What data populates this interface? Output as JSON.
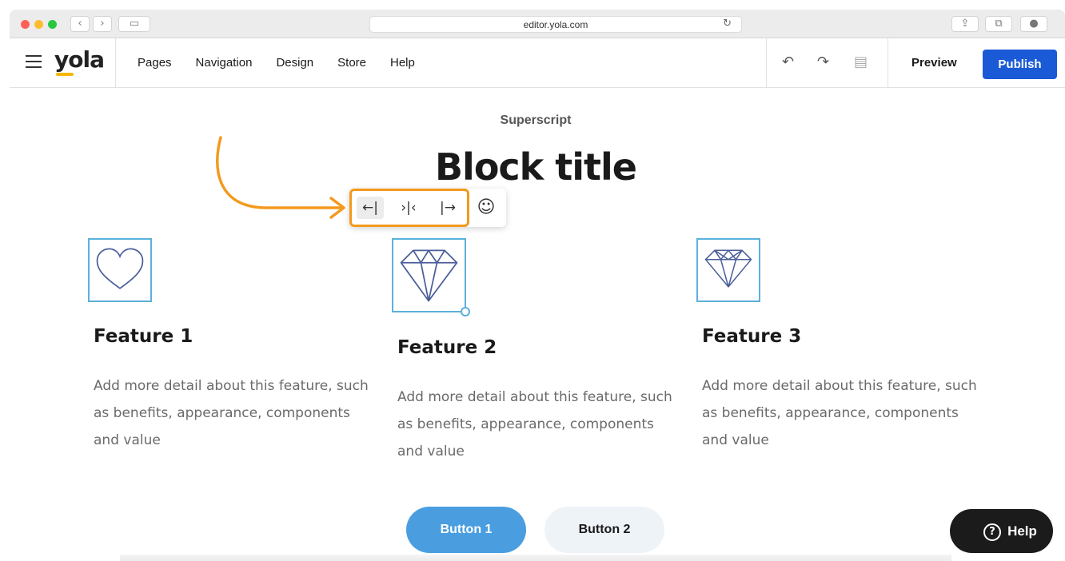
{
  "browser": {
    "url": "editor.yola.com",
    "back_icon": "‹",
    "forward_icon": "›",
    "sidebar_icon": "▭",
    "reload_icon": "↻",
    "share_icon": "⇪",
    "tabs_icon": "⧉",
    "download_icon": "●"
  },
  "header": {
    "logo": "yola",
    "nav": [
      "Pages",
      "Navigation",
      "Design",
      "Store",
      "Help"
    ],
    "undo_icon": "↶",
    "redo_icon": "↷",
    "save_icon": "▤",
    "preview_label": "Preview",
    "publish_label": "Publish",
    "colors": {
      "publish": "#1a5ad6",
      "accent": "#f39a1e"
    }
  },
  "content": {
    "superscript": "Superscript",
    "block_title": "Block title",
    "toolbar": {
      "align_left": "←|",
      "align_center": "›|‹",
      "align_right": "|→",
      "emoji": "☺"
    },
    "features": [
      {
        "title": "Feature 1",
        "description": "Add more detail about this feature, such as benefits, appearance, components and value",
        "icon": "heart-icon"
      },
      {
        "title": "Feature 2",
        "description": "Add more detail about this feature, such as benefits, appearance, components and value",
        "icon": "diamond-icon"
      },
      {
        "title": "Feature 3",
        "description": "Add more detail about this feature, such as benefits, appearance, components and value",
        "icon": "gem-icon"
      }
    ],
    "button1_label": "Button 1",
    "button2_label": "Button 2",
    "help_label": "Help",
    "help_icon": "?"
  }
}
